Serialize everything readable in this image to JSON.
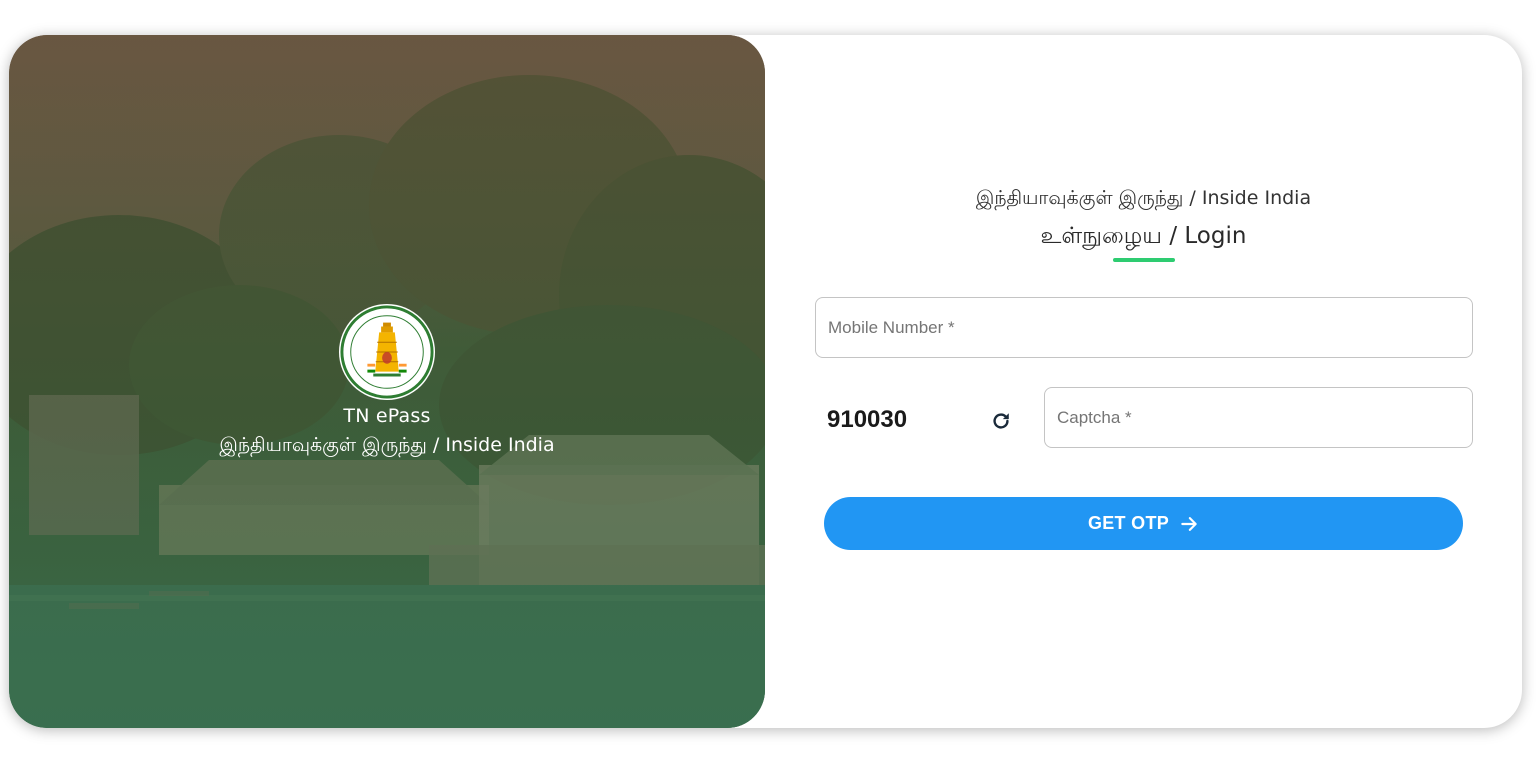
{
  "hero": {
    "app_name": "TN ePass",
    "subtitle": "இந்தியாவுக்குள் இருந்து / Inside India",
    "emblem_icon": "tamil-nadu-government-emblem-icon",
    "emblem_text_top": "GOVERNMENT OF TAMILNADU",
    "emblem_text_bottom": "TRUTH ALONE TRIUMPHS"
  },
  "form": {
    "heading": "இந்தியாவுக்குள் இருந்து / Inside India",
    "title": "உள்நுழைய / Login",
    "mobile_placeholder": "Mobile Number *",
    "captcha_code": "910030",
    "refresh_icon": "refresh-icon",
    "captcha_placeholder": "Captcha *",
    "submit_label": "GET OTP",
    "submit_icon": "arrow-right-icon"
  },
  "colors": {
    "accent": "#2196f3",
    "underline": "#2ecc71"
  }
}
